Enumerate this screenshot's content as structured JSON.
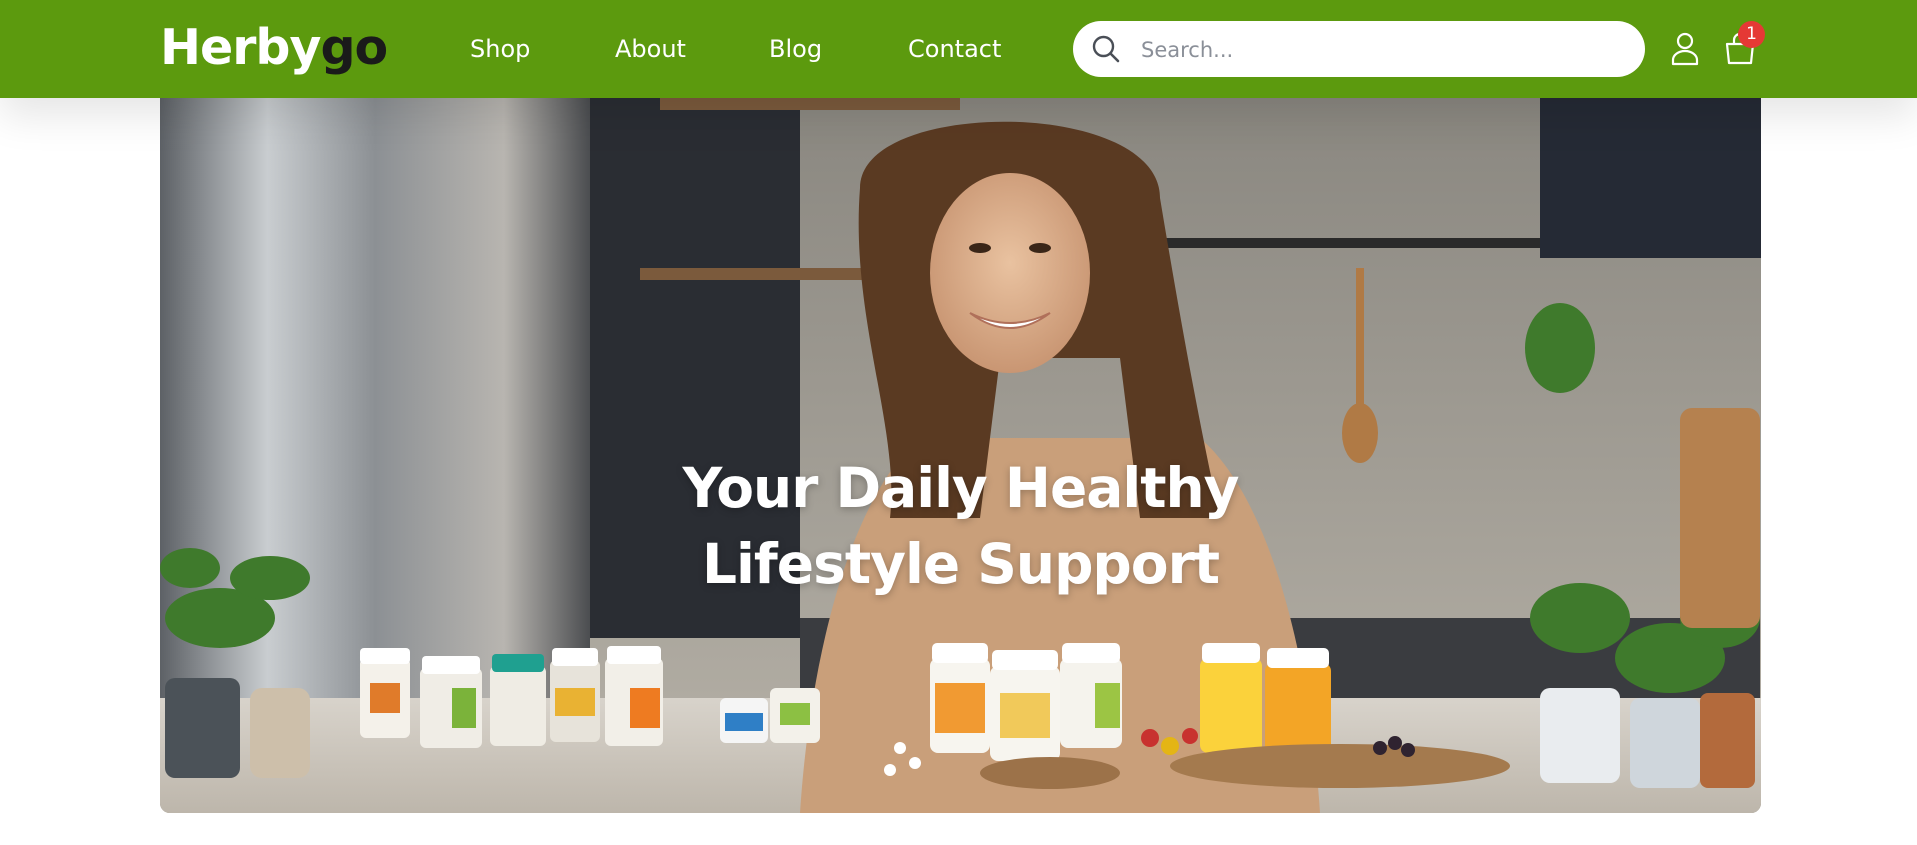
{
  "brand": {
    "logo_light": "Herby",
    "logo_dark": "go"
  },
  "nav": {
    "items": [
      "Shop",
      "About",
      "Blog",
      "Contact"
    ]
  },
  "search": {
    "placeholder": "Search..."
  },
  "header": {
    "cart_count": "1",
    "icons": [
      "search-icon",
      "account-icon",
      "cart-icon"
    ]
  },
  "hero": {
    "headline_line1": "Your Daily Healthy",
    "headline_line2": "Lifestyle Support"
  },
  "colors": {
    "header_bg": "#5c9a0e",
    "badge": "#e53935",
    "text_light": "#ffffff"
  }
}
